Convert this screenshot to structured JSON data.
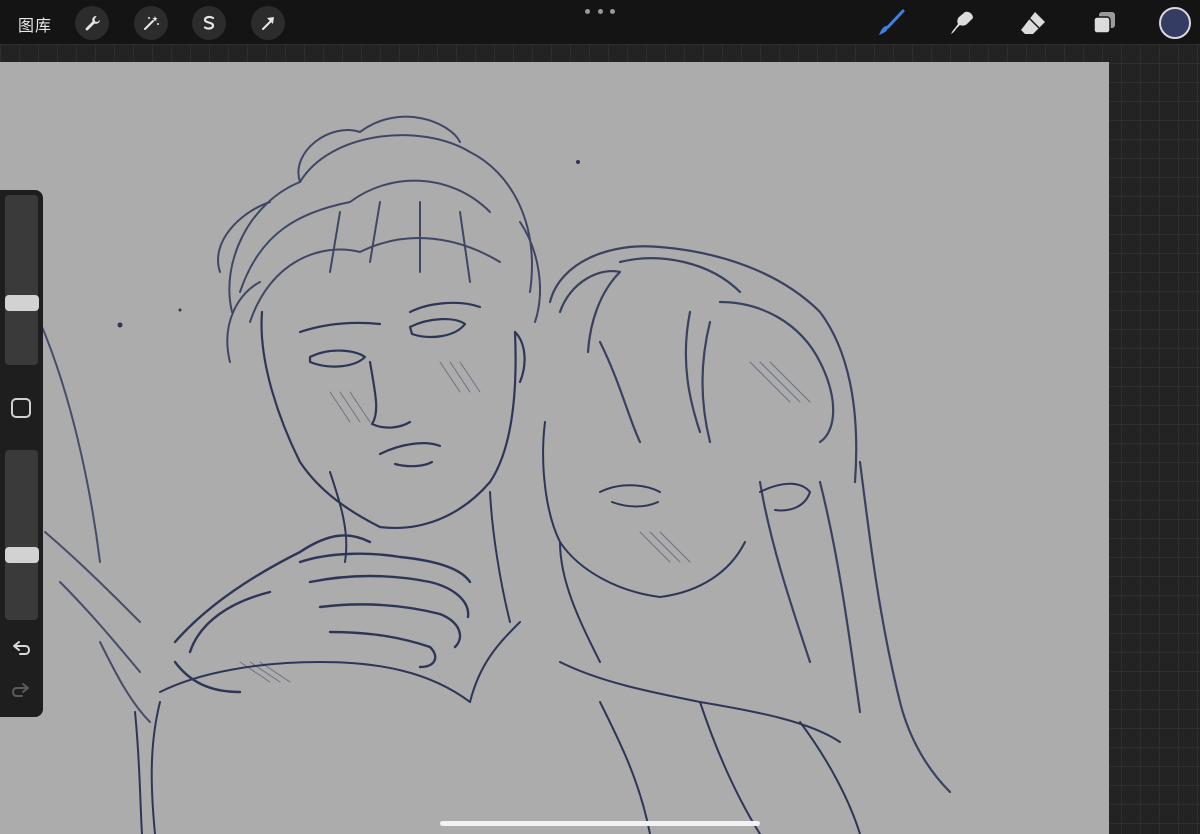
{
  "topbar": {
    "gallery_label": "图库",
    "left_tools": [
      "wrench-icon",
      "magic-wand-icon",
      "selection-icon",
      "transform-arrow-icon"
    ],
    "right_tools": [
      "brush-icon",
      "smudge-icon",
      "eraser-icon",
      "layers-icon"
    ],
    "active_tool": "brush",
    "active_color": "#343c63",
    "accent_color": "#3f7fe6"
  },
  "sidebar": {
    "brush_size": 0.35,
    "brush_opacity": 0.37
  },
  "canvas": {
    "background": "#acacac",
    "stroke_color": "#2e3658"
  }
}
